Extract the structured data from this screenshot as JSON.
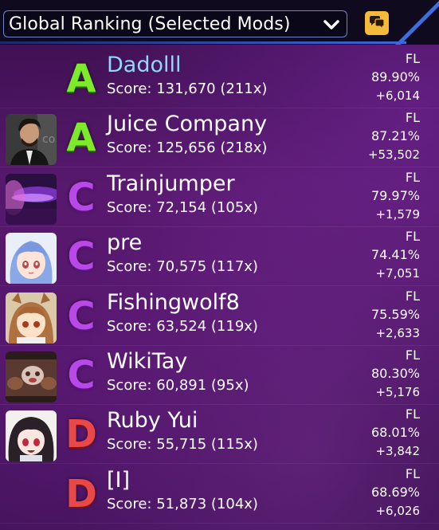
{
  "header": {
    "ranking_label": "Global Ranking (Selected Mods)"
  },
  "icons": {
    "dropdown": "chevron-down-icon",
    "chat": "chat-bubbles-icon"
  },
  "colors": {
    "grade_A": "#7dea2a",
    "grade_C": "#b848e8",
    "grade_D": "#e84848",
    "self_name": "#8fd8ff",
    "chat_button": "#f6ba3a",
    "accent_blue": "#3a6adf"
  },
  "scores": [
    {
      "grade": "A",
      "name": "Dadolll",
      "score": "Score: 131,670 (211x)",
      "mods": "FL",
      "accuracy": "89.90%",
      "diff": "+6,014",
      "avatar": "none",
      "self": true
    },
    {
      "grade": "A",
      "name": "Juice Company",
      "score": "Score: 125,656 (218x)",
      "mods": "FL",
      "accuracy": "87.21%",
      "diff": "+53,502",
      "avatar": "photo-man-suit",
      "self": false
    },
    {
      "grade": "C",
      "name": "Trainjumper",
      "score": "Score: 72,154 (105x)",
      "mods": "FL",
      "accuracy": "79.97%",
      "diff": "+1,579",
      "avatar": "purple-abstract",
      "self": false
    },
    {
      "grade": "C",
      "name": "pre",
      "score": "Score: 70,575 (117x)",
      "mods": "FL",
      "accuracy": "74.41%",
      "diff": "+7,051",
      "avatar": "anime-blue-hair",
      "self": false
    },
    {
      "grade": "C",
      "name": "Fishingwolf8",
      "score": "Score: 63,524 (119x)",
      "mods": "FL",
      "accuracy": "75.59%",
      "diff": "+2,633",
      "avatar": "anime-wolf-girl",
      "self": false
    },
    {
      "grade": "C",
      "name": "WikiTay",
      "score": "Score: 60,891 (95x)",
      "mods": "FL",
      "accuracy": "80.30%",
      "diff": "+5,176",
      "avatar": "blurry-photo",
      "self": false
    },
    {
      "grade": "D",
      "name": "Ruby Yui",
      "score": "Score: 55,715 (115x)",
      "mods": "FL",
      "accuracy": "68.01%",
      "diff": "+3,842",
      "avatar": "anime-dark-hair",
      "self": false
    },
    {
      "grade": "D",
      "name": "[I]",
      "score": "Score: 51,873 (104x)",
      "mods": "FL",
      "accuracy": "68.69%",
      "diff": "+6,026",
      "avatar": "none",
      "self": false
    }
  ]
}
